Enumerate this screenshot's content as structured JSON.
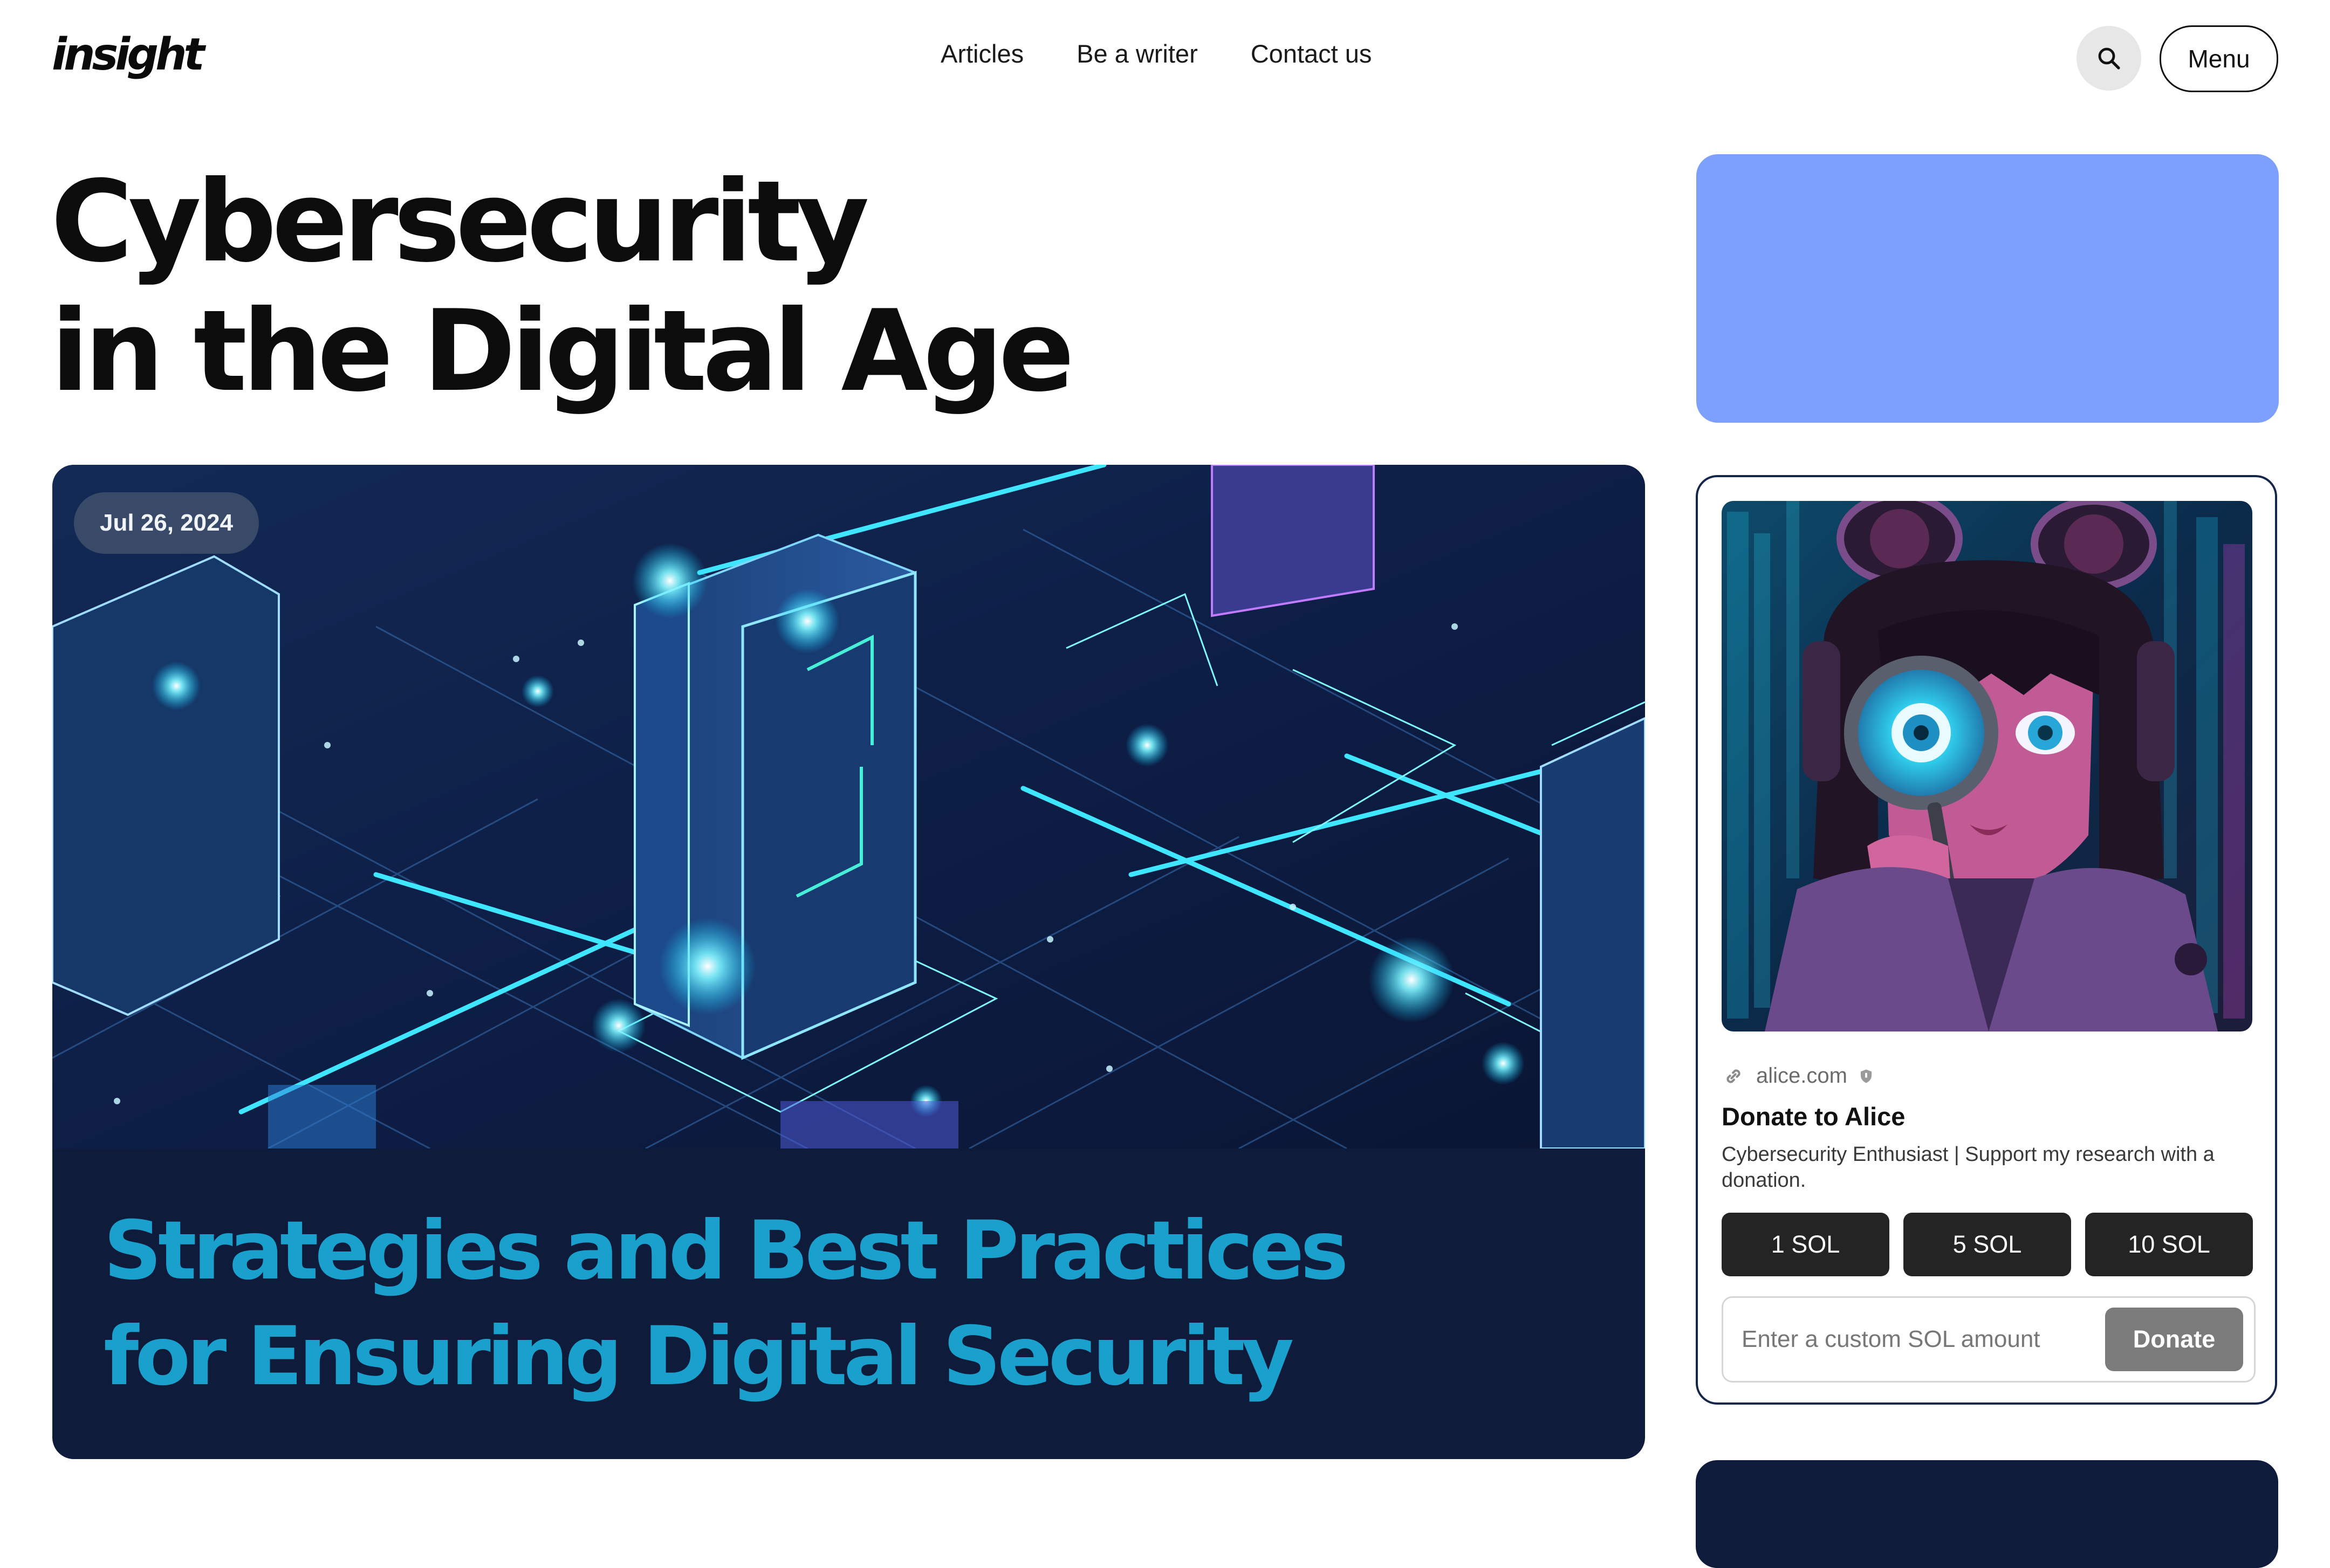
{
  "header": {
    "logo": "insight",
    "nav": [
      "Articles",
      "Be a writer",
      "Contact us"
    ],
    "search_icon": "search-icon",
    "menu_label": "Menu"
  },
  "page": {
    "title_lines": [
      "Cybersecurity",
      "in the Digital Age"
    ]
  },
  "hero": {
    "date": "Jul 26, 2024",
    "headline_lines": [
      "Strategies and Best Practices",
      "for Ensuring Digital Security"
    ],
    "headline_color": "#1aa0cc",
    "card_background": "#0e1b3a"
  },
  "sidebar": {
    "ad_color": "#7ca0fb",
    "donate": {
      "site": "alice.com",
      "title": "Donate to Alice",
      "description": "Cybersecurity Enthusiast | Support my research with a donation.",
      "amounts": [
        "1 SOL",
        "5 SOL",
        "10 SOL"
      ],
      "input_placeholder": "Enter a custom SOL amount",
      "button_label": "Donate",
      "icons": [
        "link-icon",
        "shield-icon"
      ]
    }
  }
}
